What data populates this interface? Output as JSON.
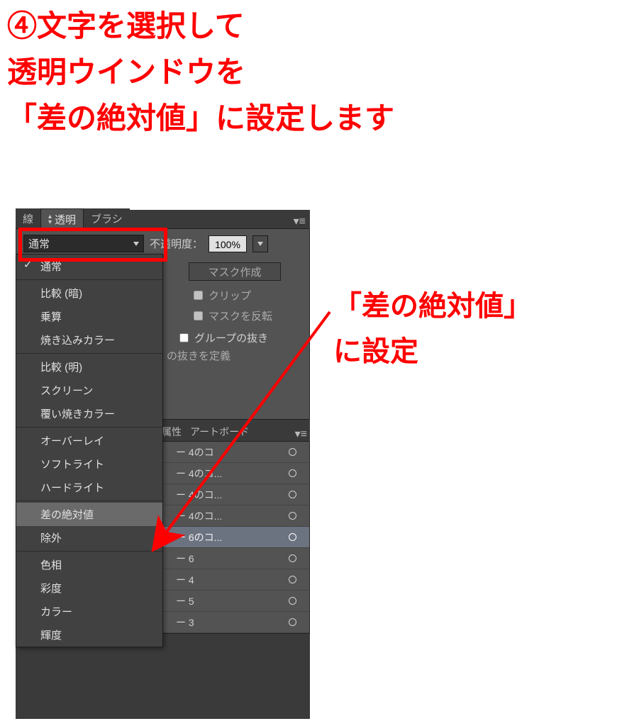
{
  "instruction": {
    "line1": "④文字を選択して",
    "line2": "透明ウインドウを",
    "line3": "「差の絶対値」に設定します"
  },
  "annotation_right": {
    "line1": "「差の絶対値」",
    "line2": "に設定"
  },
  "tabs": {
    "stroke": "線",
    "transparency": "透明",
    "brush": "ブラシ"
  },
  "transparency_panel": {
    "blend_mode_selected": "通常",
    "opacity_label": "不透明度：",
    "opacity_value": "100%",
    "mask_button": "マスク作成",
    "clip_label": "クリップ",
    "invert_mask_label": "マスクを反転",
    "group_knockout_label": "グループの抜き",
    "define_knockout_label": "の抜きを定義"
  },
  "blend_modes": {
    "normal": "通常",
    "darken": "比較 (暗)",
    "multiply": "乗算",
    "color_burn": "焼き込みカラー",
    "lighten": "比較 (明)",
    "screen": "スクリーン",
    "color_dodge": "覆い焼きカラー",
    "overlay": "オーバーレイ",
    "soft_light": "ソフトライト",
    "hard_light": "ハードライト",
    "difference": "差の絶対値",
    "exclusion": "除外",
    "hue": "色相",
    "saturation": "彩度",
    "color": "カラー",
    "luminosity": "輝度"
  },
  "lower_tabs": {
    "attributes": "属性",
    "artboard": "アートボード"
  },
  "layers": [
    {
      "name": "ー 4のコ"
    },
    {
      "name": "ー 4のコ..."
    },
    {
      "name": "ー 4のコ..."
    },
    {
      "name": "ー 4のコ..."
    },
    {
      "name": "ー 6のコ...",
      "selected": true
    },
    {
      "name": "ー 6"
    },
    {
      "name": "ー 4"
    },
    {
      "name": "ー 5"
    },
    {
      "name": "ー 3"
    }
  ]
}
